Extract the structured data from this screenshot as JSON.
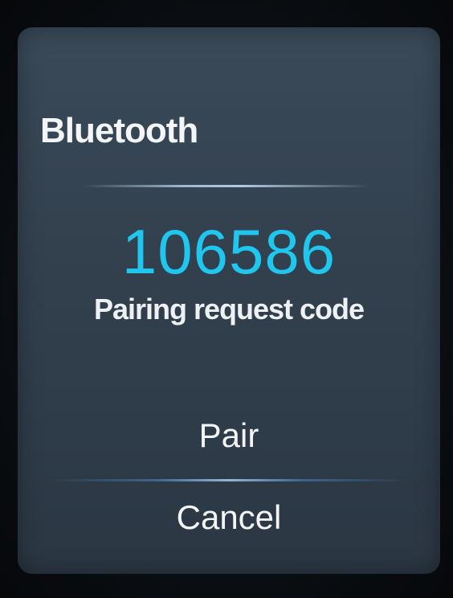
{
  "dialog": {
    "title": "Bluetooth",
    "code": "106586",
    "code_label": "Pairing request code",
    "pair_label": "Pair",
    "cancel_label": "Cancel"
  },
  "colors": {
    "code": "#1fc7ef",
    "dialog_bg": "#33414f",
    "text": "#f3f5f6"
  }
}
